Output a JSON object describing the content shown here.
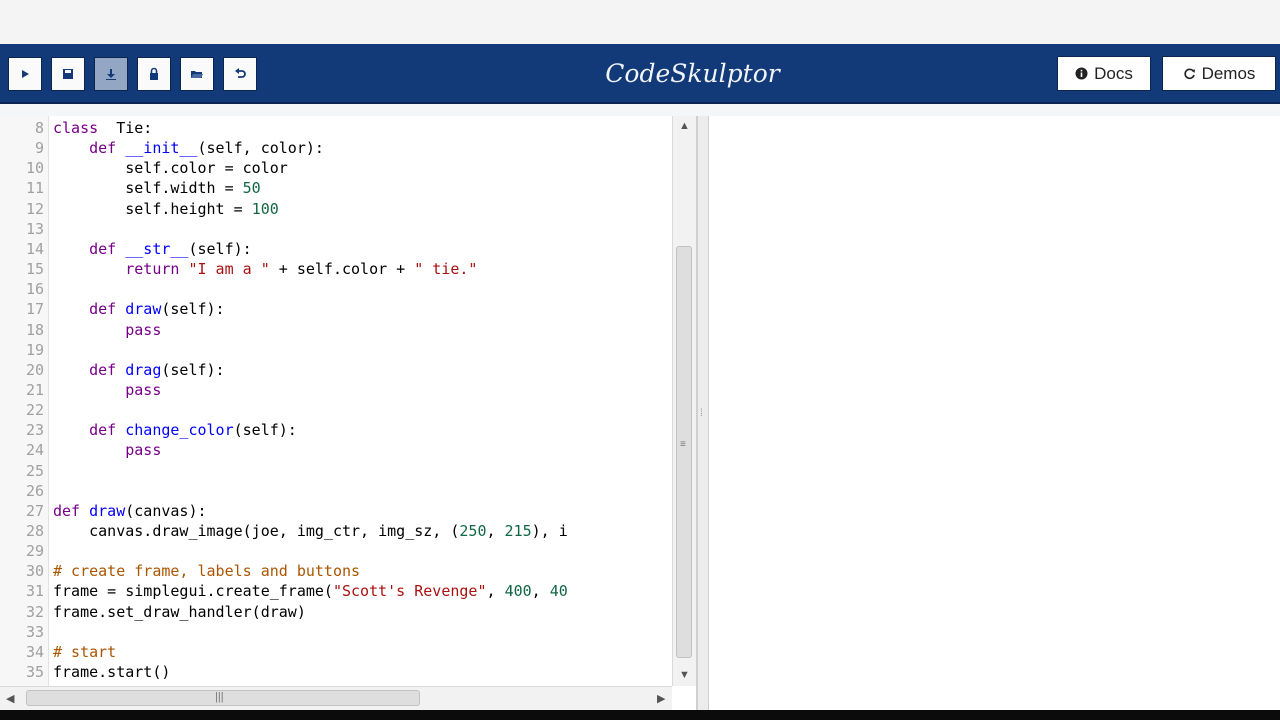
{
  "app": {
    "title": "CodeSkulptor"
  },
  "toolbar": {
    "buttons": [
      {
        "name": "run-button",
        "icon": "play-icon"
      },
      {
        "name": "save-button",
        "icon": "save-icon"
      },
      {
        "name": "download-button",
        "icon": "download-icon"
      },
      {
        "name": "fresh-url-button",
        "icon": "lock-icon"
      },
      {
        "name": "open-local-button",
        "icon": "folder-open-icon"
      },
      {
        "name": "reset-button",
        "icon": "undo-icon"
      }
    ],
    "docs_label": "Docs",
    "demos_label": "Demos"
  },
  "editor": {
    "scroll": {
      "vertical": 0.33,
      "horizontal": 0.0
    }
  },
  "colors": {
    "header": "#123a78",
    "keyword": "#770088",
    "definition": "#0000ff",
    "string": "#aa1111",
    "number": "#116644",
    "comment": "#aa5500"
  }
}
